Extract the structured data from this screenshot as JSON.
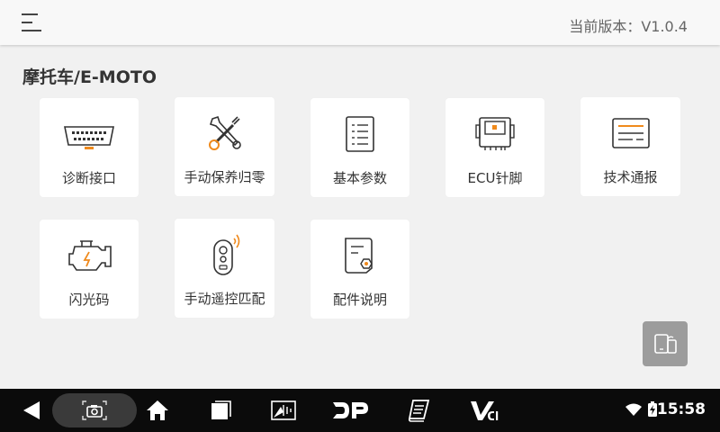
{
  "header": {
    "version_label": "当前版本：V1.0.4"
  },
  "section": {
    "title": "摩托车/E-MOTO"
  },
  "tiles": [
    {
      "label": "诊断接口",
      "icon": "obd-connector-icon"
    },
    {
      "label": "手动保养归零",
      "icon": "tools-icon"
    },
    {
      "label": "基本参数",
      "icon": "list-document-icon"
    },
    {
      "label": "ECU针脚",
      "icon": "ecu-chip-icon"
    },
    {
      "label": "技术通报",
      "icon": "bulletin-icon"
    },
    {
      "label": "闪光码",
      "icon": "engine-icon"
    },
    {
      "label": "手动遥控匹配",
      "icon": "remote-key-icon"
    },
    {
      "label": "配件说明",
      "icon": "parts-document-icon"
    }
  ],
  "statusbar": {
    "time": "15:58"
  },
  "colors": {
    "accent": "#f08a1c",
    "icon_stroke": "#333333"
  }
}
